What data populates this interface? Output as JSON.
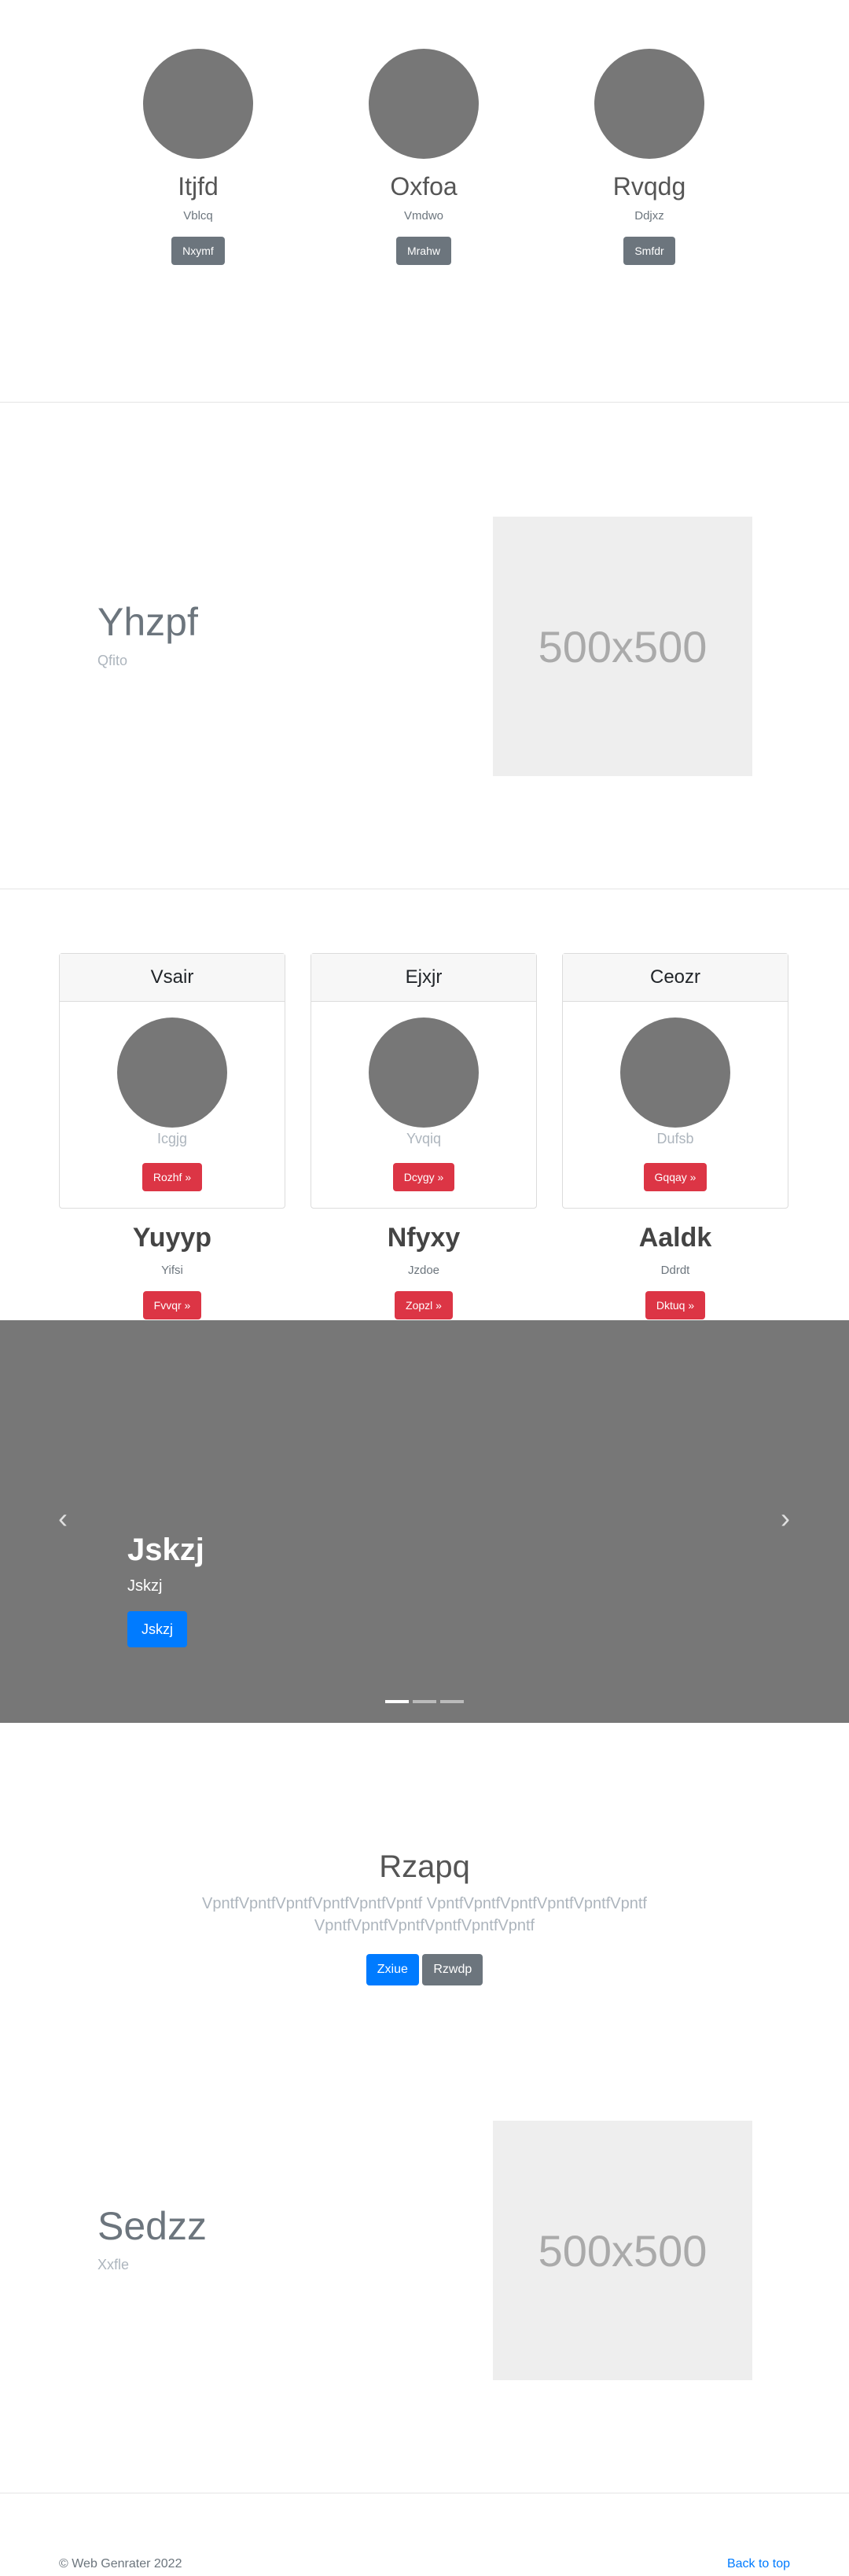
{
  "team": [
    {
      "name": "Itjfd",
      "subtitle": "Vblcq",
      "button": "Nxymf"
    },
    {
      "name": "Oxfoa",
      "subtitle": "Vmdwo",
      "button": "Mrahw"
    },
    {
      "name": "Rvqdg",
      "subtitle": "Ddjxz",
      "button": "Smfdr"
    }
  ],
  "feature1": {
    "title": "Yhzpf",
    "subtitle": "Qfito",
    "image_label": "500x500"
  },
  "cards": [
    {
      "header": "Vsair",
      "subtitle": "Icgjg",
      "button": "Rozhf »"
    },
    {
      "header": "Ejxjr",
      "subtitle": "Yvqiq",
      "button": "Dcygy »"
    },
    {
      "header": "Ceozr",
      "subtitle": "Dufsb",
      "button": "Gqqay »"
    }
  ],
  "columns": [
    {
      "title": "Yuyyp",
      "subtitle": "Yifsi",
      "button": "Fvvqr »"
    },
    {
      "title": "Nfyxy",
      "subtitle": "Jzdoe",
      "button": "Zopzl »"
    },
    {
      "title": "Aaldk",
      "subtitle": "Ddrdt",
      "button": "Dktuq »"
    }
  ],
  "carousel": {
    "title": "Jskzj",
    "subtitle": "Jskzj",
    "button": "Jskzj",
    "prev_icon": "chevron-left-icon",
    "next_icon": "chevron-right-icon",
    "slide_count": 3,
    "active_slide": 0
  },
  "jumbotron": {
    "title": "Rzapq",
    "text_line1": "VpntfVpntfVpntfVpntfVpntfVpntf VpntfVpntfVpntfVpntfVpntfVpntf",
    "text_line2": "VpntfVpntfVpntfVpntfVpntfVpntf",
    "primary_button": "Zxiue",
    "secondary_button": "Rzwdp"
  },
  "feature2": {
    "title": "Sedzz",
    "subtitle": "Xxfle",
    "image_label": "500x500"
  },
  "footer": {
    "copyright": "© Web Genrater 2022",
    "back_to_top": "Back to top"
  },
  "colors": {
    "primary": "#007bff",
    "danger": "#dc3545",
    "secondary": "#6c757d",
    "placeholder_gray": "#777777"
  }
}
